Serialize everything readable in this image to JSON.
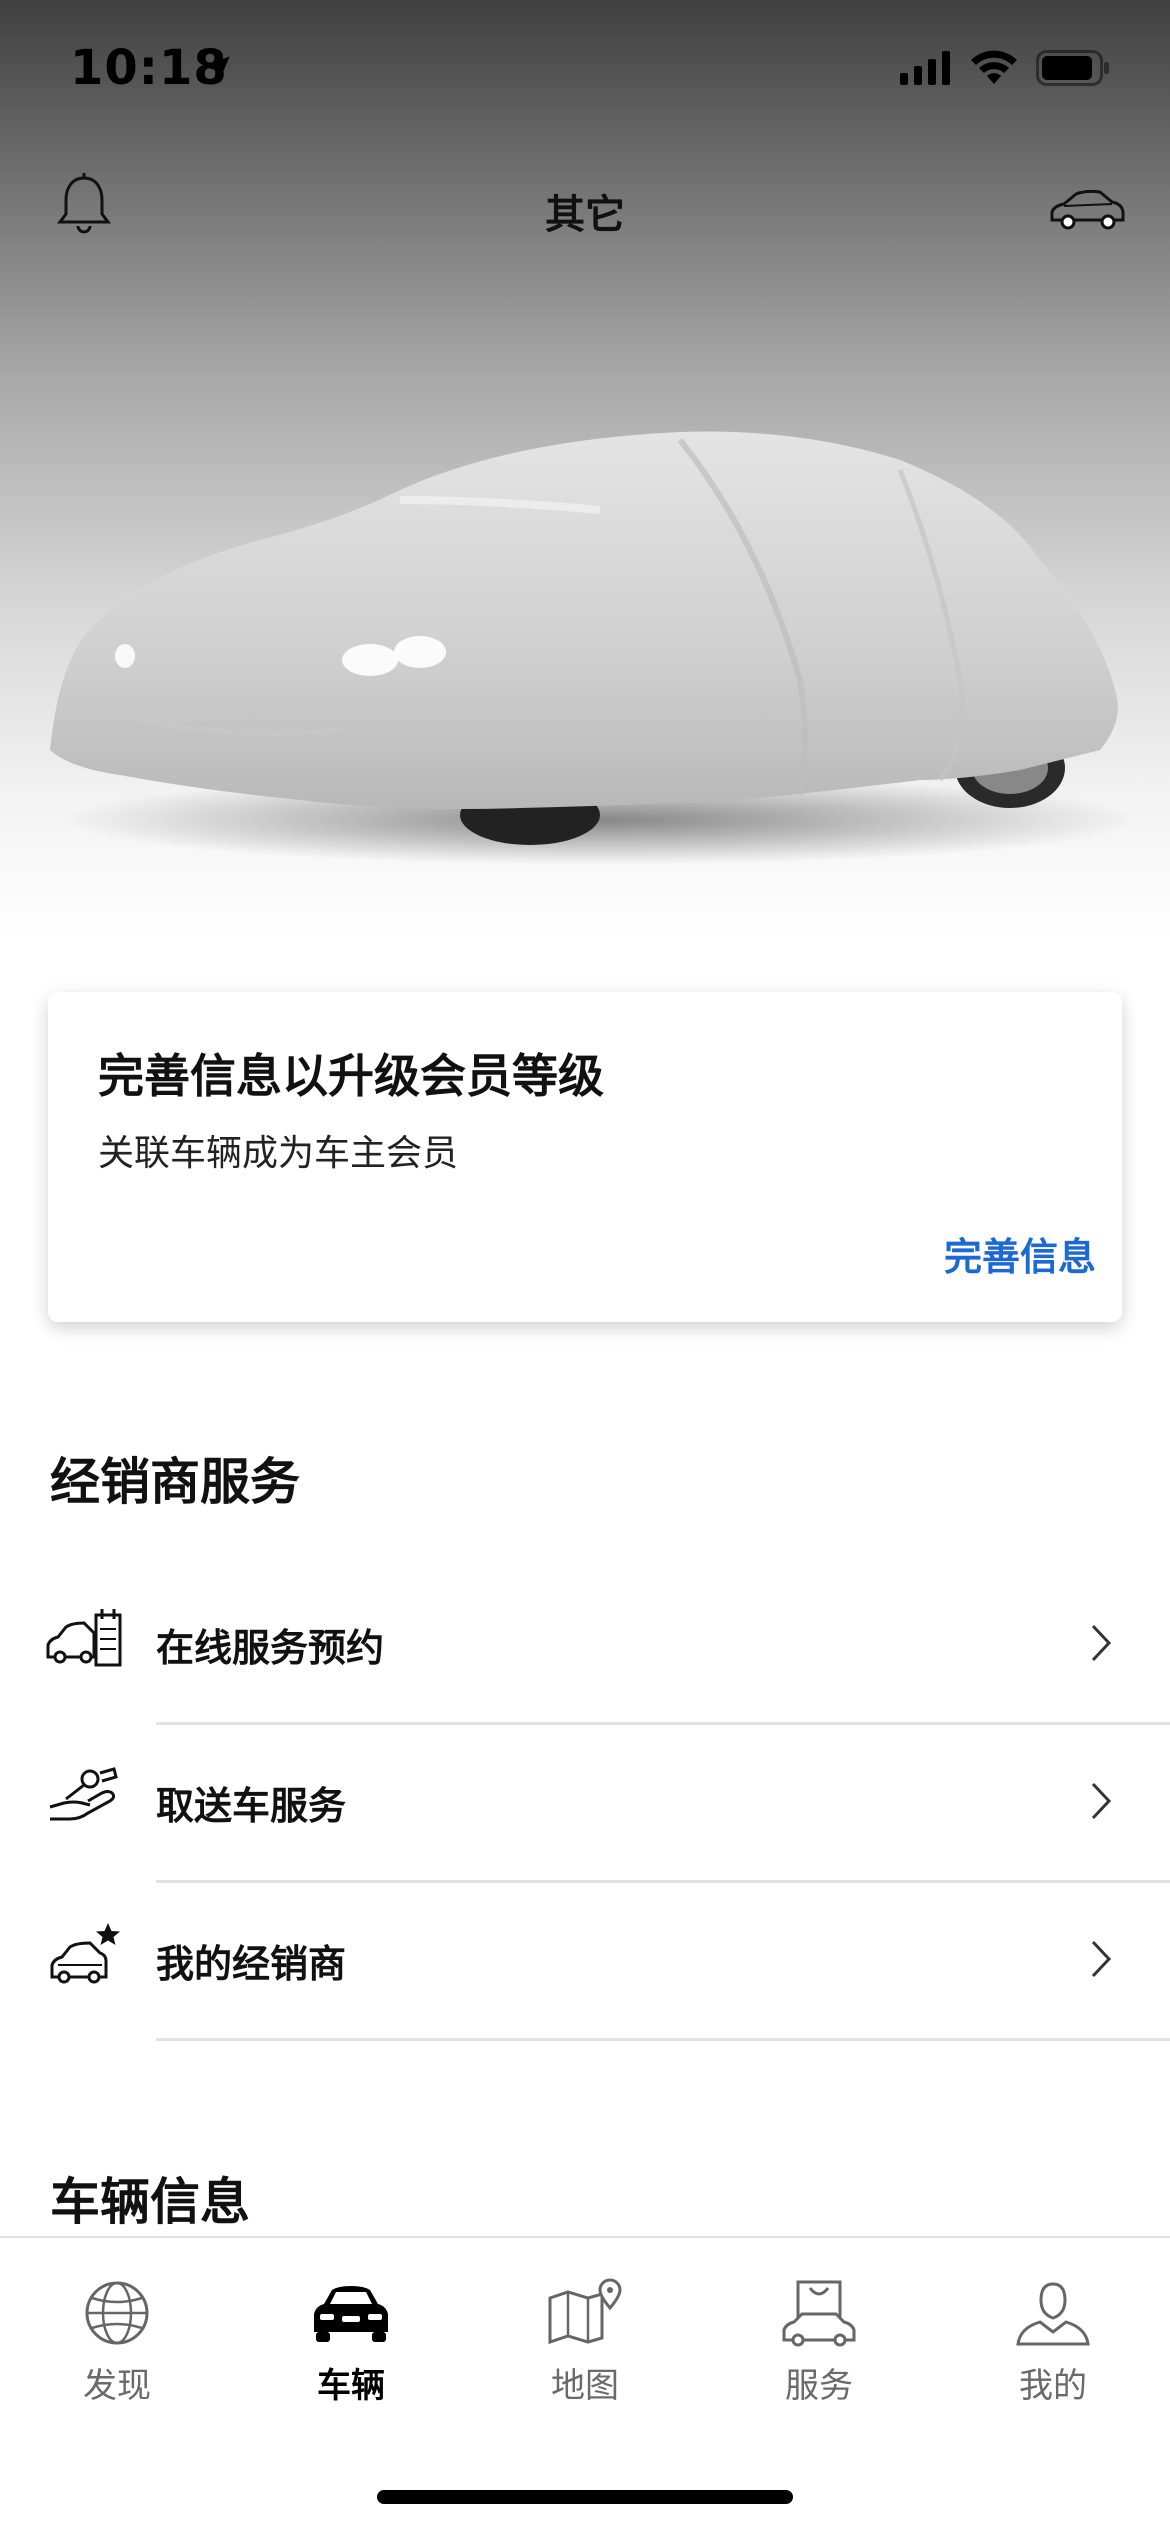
{
  "status_bar": {
    "time": "10:18"
  },
  "header": {
    "title": "其它"
  },
  "promo_card": {
    "title": "完善信息以升级会员等级",
    "subtitle": "关联车辆成为车主会员",
    "action": "完善信息"
  },
  "dealer_section": {
    "title": "经销商服务",
    "items": [
      {
        "label": "在线服务预约",
        "icon": "car-calendar-icon"
      },
      {
        "label": "取送车服务",
        "icon": "key-hand-icon"
      },
      {
        "label": "我的经销商",
        "icon": "car-star-icon"
      }
    ]
  },
  "vehicle_section": {
    "title": "车辆信息"
  },
  "tabs": [
    {
      "label": "发现",
      "icon": "globe-icon",
      "active": false
    },
    {
      "label": "车辆",
      "icon": "car-icon",
      "active": true
    },
    {
      "label": "地图",
      "icon": "map-icon",
      "active": false
    },
    {
      "label": "服务",
      "icon": "shop-car-icon",
      "active": false
    },
    {
      "label": "我的",
      "icon": "person-icon",
      "active": false
    }
  ],
  "colors": {
    "accent": "#1c69d4"
  }
}
